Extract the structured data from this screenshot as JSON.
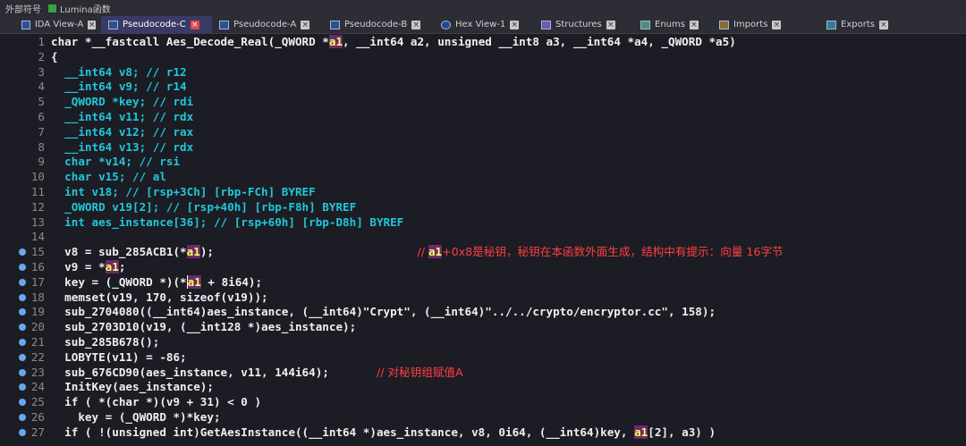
{
  "topbar": {
    "left_label": "外部符号",
    "lumina_label": "Lumina函数"
  },
  "tabs": [
    {
      "label": "IDA View-A",
      "icon": "ida-view-icon",
      "active": false
    },
    {
      "label": "Pseudocode-C",
      "icon": "pseudocode-icon",
      "active": true
    },
    {
      "label": "Pseudocode-A",
      "icon": "pseudocode-icon",
      "active": false
    },
    {
      "label": "Pseudocode-B",
      "icon": "pseudocode-icon",
      "active": false
    },
    {
      "label": "Hex View-1",
      "icon": "hex-view-icon",
      "active": false
    },
    {
      "label": "Structures",
      "icon": "structures-icon",
      "active": false
    },
    {
      "label": "Enums",
      "icon": "enums-icon",
      "active": false
    },
    {
      "label": "Imports",
      "icon": "imports-icon",
      "active": false
    },
    {
      "label": "Exports",
      "icon": "exports-icon",
      "active": false
    }
  ],
  "colors": {
    "background": "#1c1c24",
    "keyword_type": "#20c8d8",
    "comment_red": "#ff4040",
    "highlight": "#6b2a6b",
    "breakpoint": "#6aa8e8"
  },
  "code_lines": [
    {
      "num": "1",
      "bp": false,
      "segs": [
        [
          "p",
          "char *__fastcall Aes_Decode_Real(_QWORD *"
        ],
        [
          "h",
          "a1"
        ],
        [
          "p",
          ", __int64 a2, unsigned __int8 a3, __int64 *a4, _QWORD *a5)"
        ]
      ]
    },
    {
      "num": "2",
      "bp": false,
      "segs": [
        [
          "p",
          "{"
        ]
      ]
    },
    {
      "num": "3",
      "bp": false,
      "segs": [
        [
          "t",
          "  __int64 v8; // r12"
        ]
      ]
    },
    {
      "num": "4",
      "bp": false,
      "segs": [
        [
          "t",
          "  __int64 v9; // r14"
        ]
      ]
    },
    {
      "num": "5",
      "bp": false,
      "segs": [
        [
          "t",
          "  _QWORD *key; // rdi"
        ]
      ]
    },
    {
      "num": "6",
      "bp": false,
      "segs": [
        [
          "t",
          "  __int64 v11; // rdx"
        ]
      ]
    },
    {
      "num": "7",
      "bp": false,
      "segs": [
        [
          "t",
          "  __int64 v12; // rax"
        ]
      ]
    },
    {
      "num": "8",
      "bp": false,
      "segs": [
        [
          "t",
          "  __int64 v13; // rdx"
        ]
      ]
    },
    {
      "num": "9",
      "bp": false,
      "segs": [
        [
          "t",
          "  char *v14; // rsi"
        ]
      ]
    },
    {
      "num": "10",
      "bp": false,
      "segs": [
        [
          "t",
          "  char v15; // al"
        ]
      ]
    },
    {
      "num": "11",
      "bp": false,
      "segs": [
        [
          "t",
          "  int v18; // [rsp+3Ch] [rbp-FCh] BYREF"
        ]
      ]
    },
    {
      "num": "12",
      "bp": false,
      "segs": [
        [
          "t",
          "  _OWORD v19[2]; // [rsp+40h] [rbp-F8h] BYREF"
        ]
      ]
    },
    {
      "num": "13",
      "bp": false,
      "segs": [
        [
          "t",
          "  int aes_instance[36]; // [rsp+60h] [rbp-D8h] BYREF"
        ]
      ]
    },
    {
      "num": "14",
      "bp": false,
      "segs": [
        [
          "p",
          ""
        ]
      ]
    },
    {
      "num": "15",
      "bp": true,
      "segs": [
        [
          "p",
          "  v8 = sub_285ACB1(*"
        ],
        [
          "h",
          "a1"
        ],
        [
          "p",
          ");                              "
        ],
        [
          "r",
          "// "
        ],
        [
          "h",
          "a1"
        ],
        [
          "r",
          "+0x8是秘钥，秘钥在本函数外面生成，结构中有提示：向量 16字节"
        ]
      ]
    },
    {
      "num": "16",
      "bp": true,
      "segs": [
        [
          "p",
          "  v9 = *"
        ],
        [
          "h",
          "a1"
        ],
        [
          "p",
          ";"
        ]
      ]
    },
    {
      "num": "17",
      "bp": true,
      "cursor": true,
      "segs": [
        [
          "p",
          "  key = (_QWORD *)(*"
        ],
        [
          "h",
          "a1"
        ],
        [
          "p",
          " + 8i64);"
        ]
      ]
    },
    {
      "num": "18",
      "bp": true,
      "segs": [
        [
          "p",
          "  memset(v19, 170, sizeof(v19));"
        ]
      ]
    },
    {
      "num": "19",
      "bp": true,
      "segs": [
        [
          "p",
          "  sub_2704080((__int64)aes_instance, (__int64)\"Crypt\", (__int64)\"../../crypto/encryptor.cc\", 158);"
        ]
      ]
    },
    {
      "num": "20",
      "bp": true,
      "segs": [
        [
          "p",
          "  sub_2703D10(v19, (__int128 *)aes_instance);"
        ]
      ]
    },
    {
      "num": "21",
      "bp": true,
      "segs": [
        [
          "p",
          "  sub_285B678();"
        ]
      ]
    },
    {
      "num": "22",
      "bp": true,
      "segs": [
        [
          "p",
          "  LOBYTE(v11) = -86;"
        ]
      ]
    },
    {
      "num": "23",
      "bp": true,
      "segs": [
        [
          "p",
          "  sub_676CD90(aes_instance, v11, 144i64);       "
        ],
        [
          "r",
          "// 对秘钥组赋值A"
        ]
      ]
    },
    {
      "num": "24",
      "bp": true,
      "segs": [
        [
          "p",
          "  InitKey(aes_instance);"
        ]
      ]
    },
    {
      "num": "25",
      "bp": true,
      "segs": [
        [
          "p",
          "  if ( *(char *)(v9 + 31) < 0 )"
        ]
      ]
    },
    {
      "num": "26",
      "bp": true,
      "segs": [
        [
          "p",
          "    key = (_QWORD *)*key;"
        ]
      ]
    },
    {
      "num": "27",
      "bp": true,
      "segs": [
        [
          "p",
          "  if ( !(unsigned int)GetAesInstance((__int64 *)aes_instance, v8, 0i64, (__int64)key, "
        ],
        [
          "h",
          "a1"
        ],
        [
          "p",
          "[2], a3) )"
        ]
      ]
    }
  ]
}
